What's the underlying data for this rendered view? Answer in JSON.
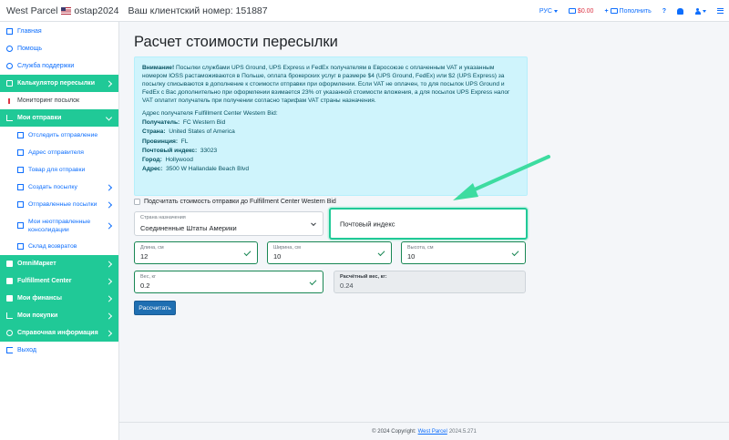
{
  "header": {
    "brand": "West Parcel",
    "username": "ostap2024",
    "client_number": "Ваш клиентский номер: 151887",
    "language": "РУС",
    "balance": "$0.00",
    "topup": "Пополнить",
    "help": "?"
  },
  "sidebar": {
    "items": [
      {
        "label": "Главная"
      },
      {
        "label": "Помощь"
      },
      {
        "label": "Служба поддержки"
      },
      {
        "label": "Калькулятор пересылки"
      },
      {
        "label": "Мониторинг посылок"
      },
      {
        "label": "Мои отправки"
      },
      {
        "label": "Отследить отправление"
      },
      {
        "label": "Адрес отправителя"
      },
      {
        "label": "Товар для отправки"
      },
      {
        "label": "Создать посылку"
      },
      {
        "label": "Отправленные посылки"
      },
      {
        "label": "Мои неотправленные консолидации"
      },
      {
        "label": "Склад возвратов"
      },
      {
        "label": "OmniMapкет"
      },
      {
        "label": "Fulfillment Center"
      },
      {
        "label": "Мои финансы"
      },
      {
        "label": "Мои покупки"
      },
      {
        "label": "Справочная информация"
      },
      {
        "label": "Выход"
      }
    ]
  },
  "main": {
    "title": "Расчет стоимости пересылки",
    "notice": {
      "heading": "Внимание!",
      "paragraph": "Посылки службами UPS Ground, UPS Express и FedEx получателям в Евросоюзе с оплаченным VAT и указанным номером IOSS растаможиваются в Польше, оплата брокерских услуг в размере $4 (UPS Ground, FedEx) или $2 (UPS Express) за посылку списываются в дополнение к стоимости отправки при оформлении. Если VAT не оплачен, то для посылок UPS Ground и FedEx с Вас дополнительно при оформлении взимается 23% от указанной стоимости вложения, а для посылок UPS Express налог VAT оплатит получатель при получении согласно тарифам VAT страны назначения.",
      "address_heading": "Адрес получателя Fulfillment Center Western Bid:",
      "rows": [
        {
          "key": "Получатель:",
          "value": "FC Western Bid"
        },
        {
          "key": "Страна:",
          "value": "United States of America"
        },
        {
          "key": "Провинция:",
          "value": "FL"
        },
        {
          "key": "Почтовый индекс:",
          "value": "33023"
        },
        {
          "key": "Город:",
          "value": "Hollywood"
        },
        {
          "key": "Адрес:",
          "value": "3500 W Hallandale Beach Blvd"
        }
      ]
    },
    "checkbox_label": "Подсчитать стоимость отправки до Fulfillment Center Western Bid",
    "form": {
      "country_label": "Страна назначения",
      "country_value": "Соединенные Штаты Америки",
      "postal_placeholder": "Почтовый индекс",
      "length_label": "Длина, см",
      "length_value": "12",
      "width_label": "Ширина, см",
      "width_value": "10",
      "height_label": "Высота, см",
      "height_value": "10",
      "weight_label": "Вес, кг",
      "weight_value": "0.2",
      "calc_weight_label": "Расчётный вес, кг:",
      "calc_weight_value": "0.24",
      "submit_label": "Рассчитать"
    }
  },
  "footer": {
    "copyright": "© 2024 Copyright:",
    "link": "West Parcel",
    "version": "2024.5.271"
  },
  "colors": {
    "accent": "#20c997",
    "link": "#0d6efd",
    "info_bg": "#cff4fc",
    "button": "#1f6fb2",
    "valid": "#198754"
  }
}
